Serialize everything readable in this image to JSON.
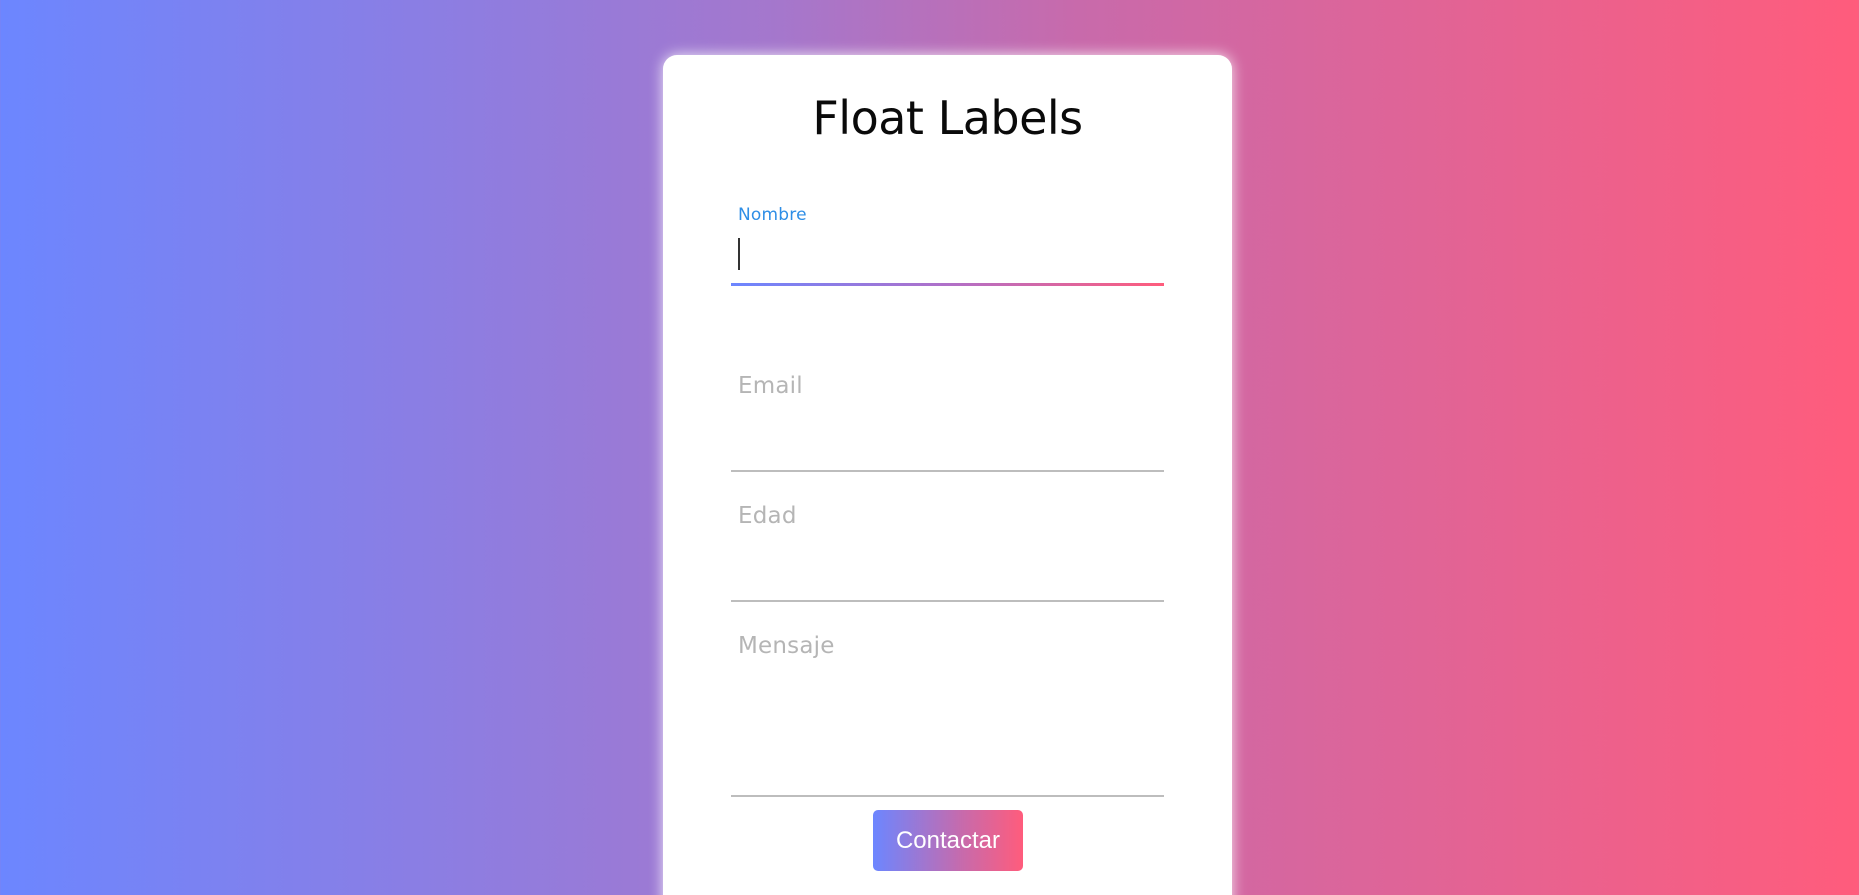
{
  "form": {
    "title": "Float Labels",
    "fields": [
      {
        "label": "Nombre",
        "value": "",
        "state": "focused"
      },
      {
        "label": "Email",
        "value": "",
        "state": "empty"
      },
      {
        "label": "Edad",
        "value": "",
        "state": "empty"
      },
      {
        "label": "Mensaje",
        "value": "",
        "state": "empty"
      }
    ],
    "submit_label": "Contactar"
  },
  "colors": {
    "gradient_start": "#6c86ff",
    "gradient_end": "#ff5c7c",
    "active_label": "#2e8ee6",
    "inactive_label": "#b5b5b5"
  }
}
